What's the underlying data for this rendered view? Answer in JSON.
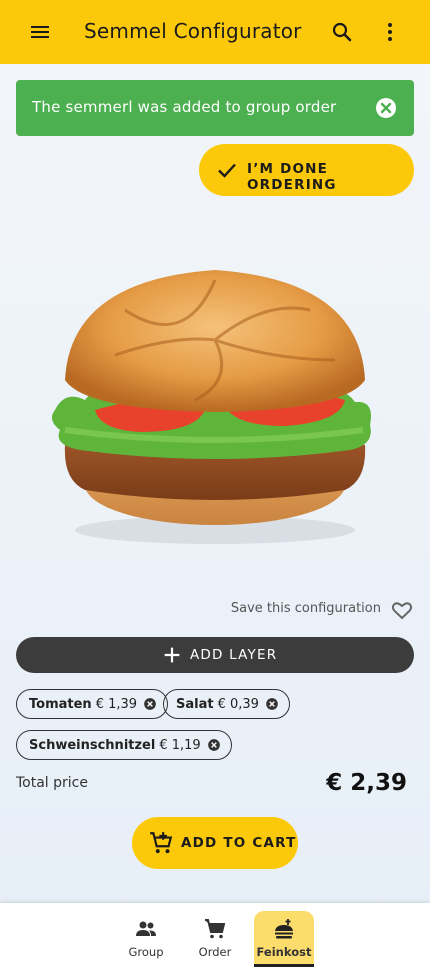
{
  "appbar": {
    "title": "Semmel Configurator",
    "menu_icon": "menu-icon",
    "search_icon": "search-icon",
    "more_icon": "more-vert-icon"
  },
  "snackbar": {
    "message": "The semmerl was added to group order",
    "close_icon": "close-circle-icon"
  },
  "done_button": {
    "label": "I’M DONE ORDERING",
    "icon": "check-icon"
  },
  "save_config": {
    "label": "Save this configuration",
    "icon": "heart-outline-icon"
  },
  "add_layer": {
    "label": "ADD LAYER",
    "icon": "plus-icon"
  },
  "layers": [
    {
      "name": "Tomaten",
      "price": "€ 1,39"
    },
    {
      "name": "Salat",
      "price": "€ 0,39"
    },
    {
      "name": "Schweinschnitzel",
      "price": "€ 1,19"
    }
  ],
  "total": {
    "label": "Total price",
    "value": "€ 2,39"
  },
  "cart_button": {
    "label": "ADD TO CART",
    "icon": "add-shopping-cart-icon"
  },
  "bottom_nav": {
    "items": [
      {
        "label": "Group",
        "icon": "group-icon"
      },
      {
        "label": "Order",
        "icon": "cart-icon"
      },
      {
        "label": "Feinkost",
        "icon": "food-icon",
        "active": true
      }
    ]
  },
  "colors": {
    "accent": "#fcc90a",
    "success": "#4caf50",
    "dark": "#3c3c3c"
  }
}
